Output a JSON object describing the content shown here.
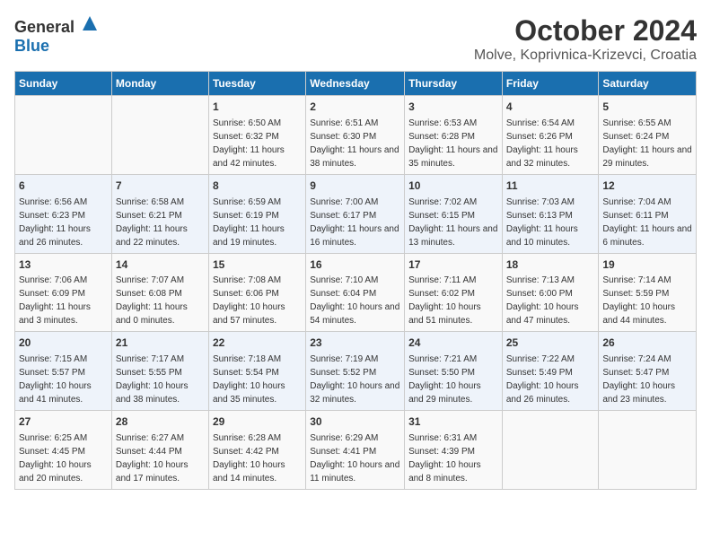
{
  "header": {
    "logo_general": "General",
    "logo_blue": "Blue",
    "month": "October 2024",
    "location": "Molve, Koprivnica-Krizevci, Croatia"
  },
  "calendar": {
    "days_of_week": [
      "Sunday",
      "Monday",
      "Tuesday",
      "Wednesday",
      "Thursday",
      "Friday",
      "Saturday"
    ],
    "weeks": [
      [
        {
          "day": "",
          "info": ""
        },
        {
          "day": "",
          "info": ""
        },
        {
          "day": "1",
          "info": "Sunrise: 6:50 AM\nSunset: 6:32 PM\nDaylight: 11 hours and 42 minutes."
        },
        {
          "day": "2",
          "info": "Sunrise: 6:51 AM\nSunset: 6:30 PM\nDaylight: 11 hours and 38 minutes."
        },
        {
          "day": "3",
          "info": "Sunrise: 6:53 AM\nSunset: 6:28 PM\nDaylight: 11 hours and 35 minutes."
        },
        {
          "day": "4",
          "info": "Sunrise: 6:54 AM\nSunset: 6:26 PM\nDaylight: 11 hours and 32 minutes."
        },
        {
          "day": "5",
          "info": "Sunrise: 6:55 AM\nSunset: 6:24 PM\nDaylight: 11 hours and 29 minutes."
        }
      ],
      [
        {
          "day": "6",
          "info": "Sunrise: 6:56 AM\nSunset: 6:23 PM\nDaylight: 11 hours and 26 minutes."
        },
        {
          "day": "7",
          "info": "Sunrise: 6:58 AM\nSunset: 6:21 PM\nDaylight: 11 hours and 22 minutes."
        },
        {
          "day": "8",
          "info": "Sunrise: 6:59 AM\nSunset: 6:19 PM\nDaylight: 11 hours and 19 minutes."
        },
        {
          "day": "9",
          "info": "Sunrise: 7:00 AM\nSunset: 6:17 PM\nDaylight: 11 hours and 16 minutes."
        },
        {
          "day": "10",
          "info": "Sunrise: 7:02 AM\nSunset: 6:15 PM\nDaylight: 11 hours and 13 minutes."
        },
        {
          "day": "11",
          "info": "Sunrise: 7:03 AM\nSunset: 6:13 PM\nDaylight: 11 hours and 10 minutes."
        },
        {
          "day": "12",
          "info": "Sunrise: 7:04 AM\nSunset: 6:11 PM\nDaylight: 11 hours and 6 minutes."
        }
      ],
      [
        {
          "day": "13",
          "info": "Sunrise: 7:06 AM\nSunset: 6:09 PM\nDaylight: 11 hours and 3 minutes."
        },
        {
          "day": "14",
          "info": "Sunrise: 7:07 AM\nSunset: 6:08 PM\nDaylight: 11 hours and 0 minutes."
        },
        {
          "day": "15",
          "info": "Sunrise: 7:08 AM\nSunset: 6:06 PM\nDaylight: 10 hours and 57 minutes."
        },
        {
          "day": "16",
          "info": "Sunrise: 7:10 AM\nSunset: 6:04 PM\nDaylight: 10 hours and 54 minutes."
        },
        {
          "day": "17",
          "info": "Sunrise: 7:11 AM\nSunset: 6:02 PM\nDaylight: 10 hours and 51 minutes."
        },
        {
          "day": "18",
          "info": "Sunrise: 7:13 AM\nSunset: 6:00 PM\nDaylight: 10 hours and 47 minutes."
        },
        {
          "day": "19",
          "info": "Sunrise: 7:14 AM\nSunset: 5:59 PM\nDaylight: 10 hours and 44 minutes."
        }
      ],
      [
        {
          "day": "20",
          "info": "Sunrise: 7:15 AM\nSunset: 5:57 PM\nDaylight: 10 hours and 41 minutes."
        },
        {
          "day": "21",
          "info": "Sunrise: 7:17 AM\nSunset: 5:55 PM\nDaylight: 10 hours and 38 minutes."
        },
        {
          "day": "22",
          "info": "Sunrise: 7:18 AM\nSunset: 5:54 PM\nDaylight: 10 hours and 35 minutes."
        },
        {
          "day": "23",
          "info": "Sunrise: 7:19 AM\nSunset: 5:52 PM\nDaylight: 10 hours and 32 minutes."
        },
        {
          "day": "24",
          "info": "Sunrise: 7:21 AM\nSunset: 5:50 PM\nDaylight: 10 hours and 29 minutes."
        },
        {
          "day": "25",
          "info": "Sunrise: 7:22 AM\nSunset: 5:49 PM\nDaylight: 10 hours and 26 minutes."
        },
        {
          "day": "26",
          "info": "Sunrise: 7:24 AM\nSunset: 5:47 PM\nDaylight: 10 hours and 23 minutes."
        }
      ],
      [
        {
          "day": "27",
          "info": "Sunrise: 6:25 AM\nSunset: 4:45 PM\nDaylight: 10 hours and 20 minutes."
        },
        {
          "day": "28",
          "info": "Sunrise: 6:27 AM\nSunset: 4:44 PM\nDaylight: 10 hours and 17 minutes."
        },
        {
          "day": "29",
          "info": "Sunrise: 6:28 AM\nSunset: 4:42 PM\nDaylight: 10 hours and 14 minutes."
        },
        {
          "day": "30",
          "info": "Sunrise: 6:29 AM\nSunset: 4:41 PM\nDaylight: 10 hours and 11 minutes."
        },
        {
          "day": "31",
          "info": "Sunrise: 6:31 AM\nSunset: 4:39 PM\nDaylight: 10 hours and 8 minutes."
        },
        {
          "day": "",
          "info": ""
        },
        {
          "day": "",
          "info": ""
        }
      ]
    ]
  }
}
